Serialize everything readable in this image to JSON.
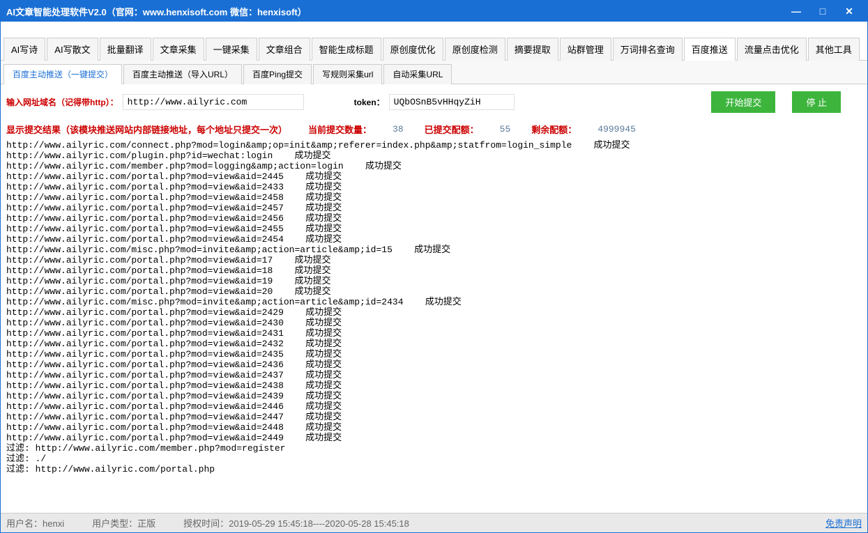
{
  "window": {
    "title": "AI文章智能处理软件V2.0（官网：www.henxisoft.com  微信：henxisoft）"
  },
  "main_tabs": [
    "AI写诗",
    "AI写散文",
    "批量翻译",
    "文章采集",
    "一键采集",
    "文章组合",
    "智能生成标题",
    "原创度优化",
    "原创度检测",
    "摘要提取",
    "站群管理",
    "万词排名查询",
    "百度推送",
    "流量点击优化",
    "其他工具"
  ],
  "main_tab_active_index": 12,
  "sub_tabs": [
    "百度主动推送（一键提交）",
    "百度主动推送（导入URL）",
    "百度Ping提交",
    "写规则采集url",
    "自动采集URL"
  ],
  "sub_tab_active_index": 0,
  "form": {
    "domain_label": "输入网址域名（记得带http）：",
    "domain_value": "http://www.ailyric.com",
    "token_label": "token：",
    "token_value": "UQbOSnB5vHHqyZiH",
    "start_btn": "开始提交",
    "stop_btn": "停  止"
  },
  "result": {
    "header_label": "显示提交结果（该模块推送网站内部链接地址，每个地址只提交一次）",
    "current_label": "当前提交数量：",
    "current_value": "38",
    "submitted_label": "已提交配额：",
    "submitted_value": "55",
    "remain_label": "剩余配额：",
    "remain_value": "4999945"
  },
  "log_lines": [
    "http://www.ailyric.com/connect.php?mod=login&amp;op=init&amp;referer=index.php&amp;statfrom=login_simple    成功提交",
    "http://www.ailyric.com/plugin.php?id=wechat:login    成功提交",
    "http://www.ailyric.com/member.php?mod=logging&amp;action=login    成功提交",
    "http://www.ailyric.com/portal.php?mod=view&aid=2445    成功提交",
    "http://www.ailyric.com/portal.php?mod=view&aid=2433    成功提交",
    "http://www.ailyric.com/portal.php?mod=view&aid=2458    成功提交",
    "http://www.ailyric.com/portal.php?mod=view&aid=2457    成功提交",
    "http://www.ailyric.com/portal.php?mod=view&aid=2456    成功提交",
    "http://www.ailyric.com/portal.php?mod=view&aid=2455    成功提交",
    "http://www.ailyric.com/portal.php?mod=view&aid=2454    成功提交",
    "http://www.ailyric.com/misc.php?mod=invite&amp;action=article&amp;id=15    成功提交",
    "http://www.ailyric.com/portal.php?mod=view&aid=17    成功提交",
    "http://www.ailyric.com/portal.php?mod=view&aid=18    成功提交",
    "http://www.ailyric.com/portal.php?mod=view&aid=19    成功提交",
    "http://www.ailyric.com/portal.php?mod=view&aid=20    成功提交",
    "http://www.ailyric.com/misc.php?mod=invite&amp;action=article&amp;id=2434    成功提交",
    "http://www.ailyric.com/portal.php?mod=view&aid=2429    成功提交",
    "http://www.ailyric.com/portal.php?mod=view&aid=2430    成功提交",
    "http://www.ailyric.com/portal.php?mod=view&aid=2431    成功提交",
    "http://www.ailyric.com/portal.php?mod=view&aid=2432    成功提交",
    "http://www.ailyric.com/portal.php?mod=view&aid=2435    成功提交",
    "http://www.ailyric.com/portal.php?mod=view&aid=2436    成功提交",
    "http://www.ailyric.com/portal.php?mod=view&aid=2437    成功提交",
    "http://www.ailyric.com/portal.php?mod=view&aid=2438    成功提交",
    "http://www.ailyric.com/portal.php?mod=view&aid=2439    成功提交",
    "http://www.ailyric.com/portal.php?mod=view&aid=2446    成功提交",
    "http://www.ailyric.com/portal.php?mod=view&aid=2447    成功提交",
    "http://www.ailyric.com/portal.php?mod=view&aid=2448    成功提交",
    "http://www.ailyric.com/portal.php?mod=view&aid=2449    成功提交",
    "",
    "过滤: http://www.ailyric.com/member.php?mod=register",
    "过滤: ./",
    "过滤: http://www.ailyric.com/portal.php"
  ],
  "status": {
    "user_label": "用户名：",
    "user_value": "henxi",
    "type_label": "用户类型：",
    "type_value": "正版",
    "auth_label": "授权时间：",
    "auth_value": "2019-05-29 15:45:18----2020-05-28 15:45:18",
    "disclaimer": "免责声明"
  }
}
